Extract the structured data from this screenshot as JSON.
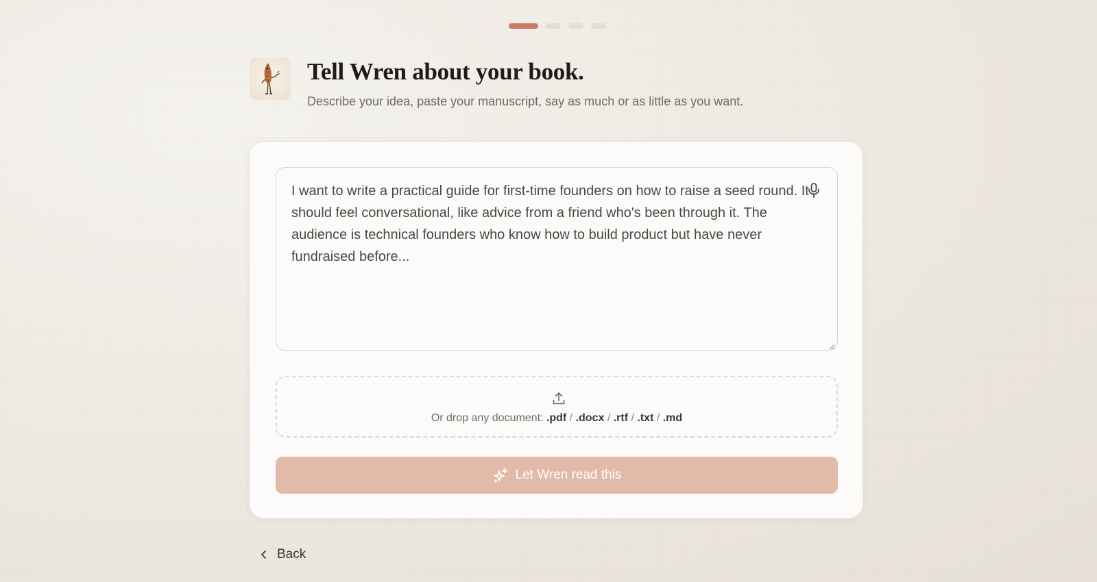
{
  "progress": {
    "steps": 4,
    "current": 1,
    "colors": {
      "active": "#c97b62",
      "inactive": "#e2ddd6"
    }
  },
  "header": {
    "mascot_icon": "quill-bird-mascot-icon",
    "title": "Tell Wren about your book.",
    "subtitle": "Describe your idea, paste your manuscript, say as much or as little as you want."
  },
  "composer": {
    "text": "I want to write a practical guide for first-time founders on how to raise a seed round. It should feel conversational, like advice from a friend who's been through it. The audience is technical founders who know how to build product but have never fundraised before...",
    "mic_icon": "microphone-icon"
  },
  "dropzone": {
    "icon": "upload-icon",
    "prefix": "Or drop any document:",
    "formats": [
      ".pdf",
      ".docx",
      ".rtf",
      ".txt",
      ".md"
    ],
    "separator": " / "
  },
  "submit": {
    "icon": "sparkles-icon",
    "label": "Let Wren read this",
    "color": "#e3b9aa"
  },
  "back": {
    "icon": "chevron-left-icon",
    "label": "Back"
  }
}
